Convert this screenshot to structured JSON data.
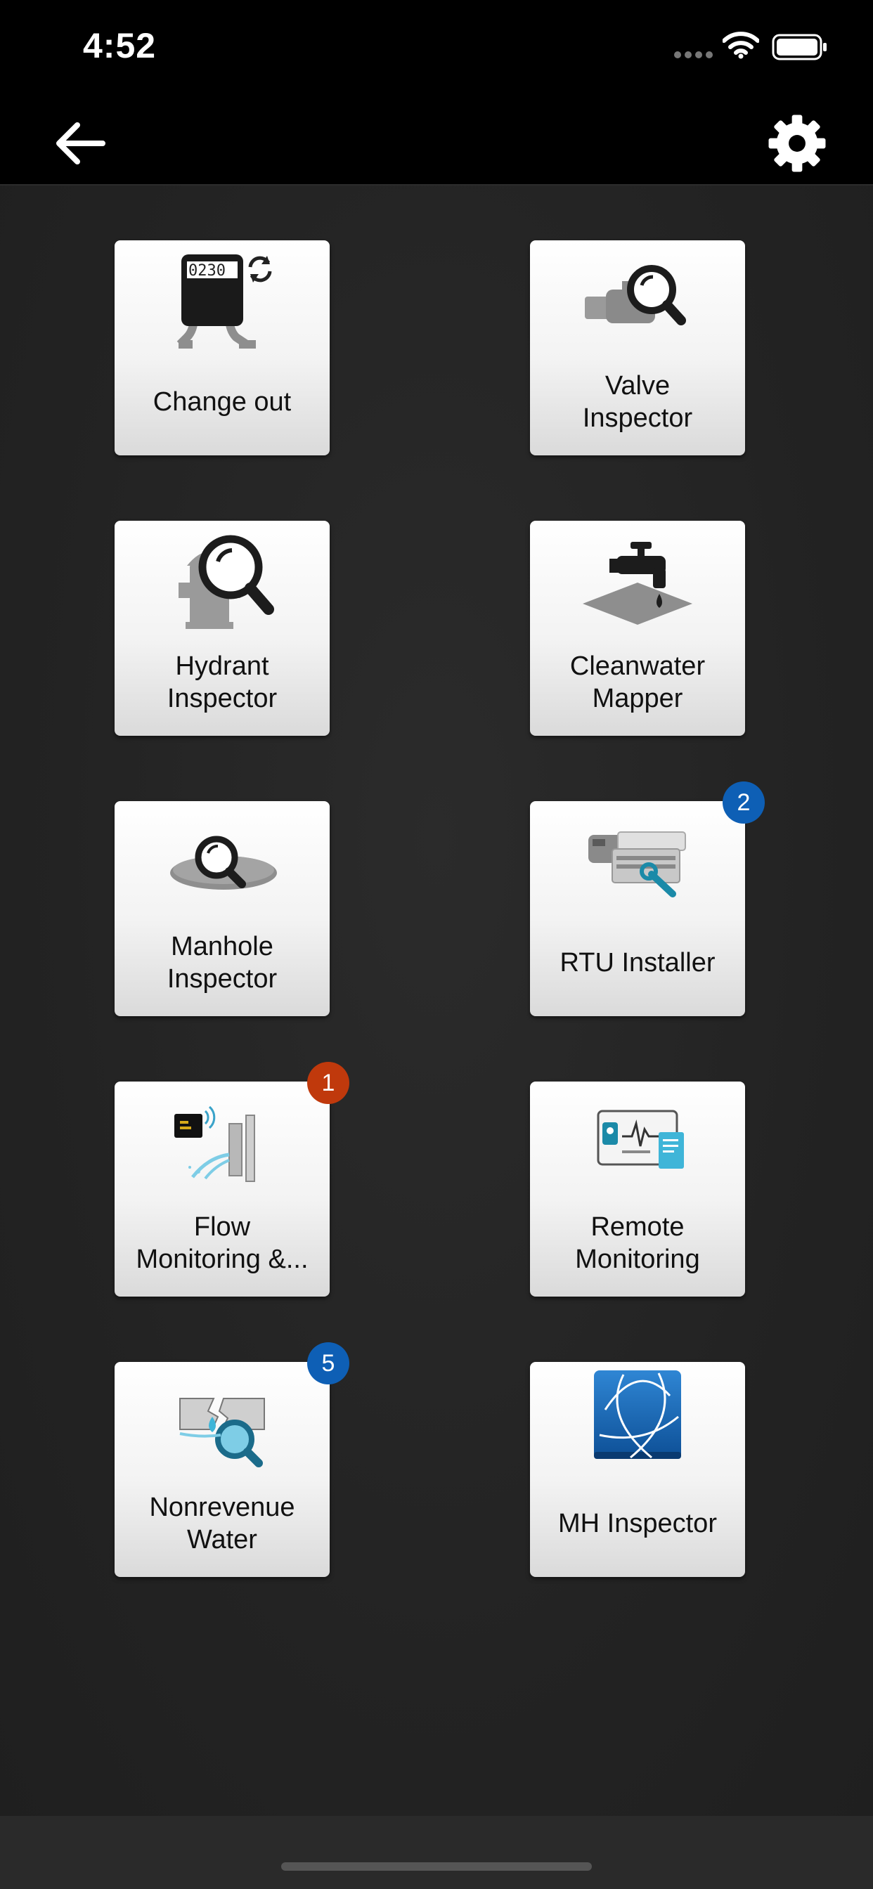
{
  "status_bar": {
    "time": "4:52",
    "icons": [
      "signal-dots-icon",
      "wifi-icon",
      "battery-icon"
    ]
  },
  "nav": {
    "back_icon": "back-arrow-icon",
    "settings_icon": "gear-icon"
  },
  "tiles": [
    {
      "label": "Change out",
      "icon": "meter-change-icon",
      "badge": null
    },
    {
      "label": "Valve\nInspector",
      "icon": "valve-inspector-icon",
      "badge": null
    },
    {
      "label": "Hydrant\nInspector",
      "icon": "hydrant-inspector-icon",
      "badge": null
    },
    {
      "label": "Cleanwater\nMapper",
      "icon": "faucet-mapper-icon",
      "badge": null
    },
    {
      "label": "Manhole\nInspector",
      "icon": "manhole-inspector-icon",
      "badge": null
    },
    {
      "label": "RTU Installer",
      "icon": "rtu-installer-icon",
      "badge": "2"
    },
    {
      "label": "Flow\nMonitoring &...",
      "icon": "flow-monitoring-icon",
      "badge": "1"
    },
    {
      "label": "Remote\nMonitoring",
      "icon": "remote-monitoring-icon",
      "badge": null
    },
    {
      "label": "Nonrevenue\nWater",
      "icon": "nonrevenue-water-icon",
      "badge": "5"
    },
    {
      "label": "MH Inspector",
      "icon": "mh-inspector-icon",
      "badge": null
    }
  ],
  "colors": {
    "badge_blue": "#0e5fb5",
    "badge_red": "#c0390c",
    "background": "#232323",
    "bar": "#000000"
  }
}
